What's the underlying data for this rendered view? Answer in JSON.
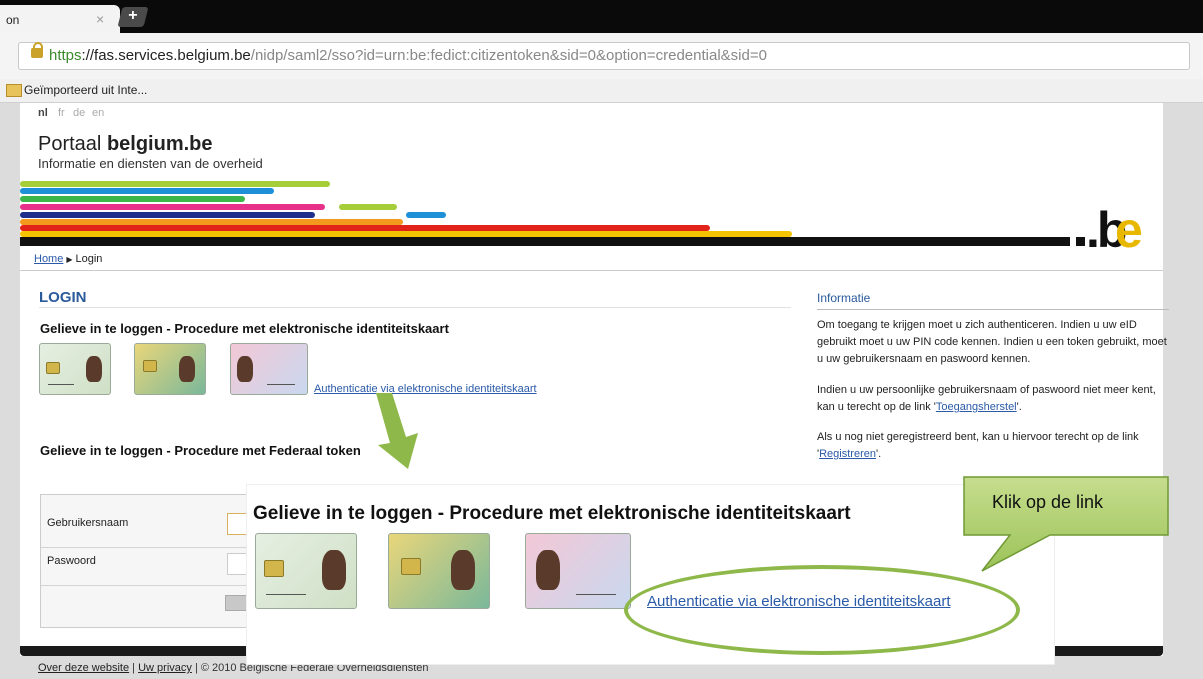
{
  "browser": {
    "tab_title": "on",
    "tab_close": "×",
    "newtab_label": "+",
    "url_scheme": "https",
    "url_host": "://fas.services.belgium.be",
    "url_rest": "/nidp/saml2/sso?id=urn:be:fedict:citizentoken&sid=0&option=credential&sid=0",
    "bookmark_folder": "Geïmporteerd uit Inte..."
  },
  "page": {
    "languages": [
      "nl",
      "fr",
      "de",
      "en"
    ],
    "portal_prefix": "Portaal",
    "portal_brand": "belgium.be",
    "portal_sub": "Informatie en diensten van de overheid",
    "logo_b": ".b",
    "logo_e": "e",
    "breadcrumb_home": "Home",
    "breadcrumb_sep": "▶",
    "breadcrumb_current": "Login",
    "login_title": "LOGIN",
    "eid_heading": "Gelieve in te loggen - Procedure met elektronische identiteitskaart",
    "eid_link": "Authenticatie via elektronische identiteitskaart",
    "federal_heading": "Gelieve in te loggen - Procedure met Federaal token",
    "username_label": "Gebruikersnaam",
    "password_label": "Paswoord"
  },
  "info": {
    "title": "Informatie",
    "p1": "Om toegang te krijgen moet u zich authenticeren. Indien u uw eID gebruikt moet u uw PIN code kennen. Indien u een token gebruikt, moet u uw gebruikersnaam en paswoord kennen.",
    "p2_text": "Indien u uw persoonlijke gebruikersnaam of paswoord niet meer kent, kan u terecht op de link '",
    "p2_link": "Toegangsherstel",
    "p2_end": "'.",
    "p3_text": "Als u nog niet geregistreerd bent, kan u hiervoor terecht op de link '",
    "p3_link": "Registreren",
    "p3_end": "'."
  },
  "footer": {
    "about": "Over deze website",
    "privacy": "Uw privacy",
    "sep": "|",
    "copyright": "| © 2010 Belgische Federale Overheidsdiensten"
  },
  "annotation": {
    "zoom_heading": "Gelieve in te loggen - Procedure met elektronische identiteitskaart",
    "zoom_link": "Authenticatie via elektronische identiteitskaart",
    "callout_text": "Klik op de link"
  },
  "colors": {
    "stripe_lime": "#a6ce39",
    "stripe_blue": "#1e90d8",
    "stripe_green": "#3cb54a",
    "stripe_pink": "#e8308a",
    "stripe_navy": "#1f2e8c",
    "stripe_orange": "#f39a1e",
    "stripe_red": "#e2231a",
    "stripe_yellow": "#f5c400",
    "accent_blue": "#2a5a9a",
    "annotation_green": "#8fb84a"
  }
}
